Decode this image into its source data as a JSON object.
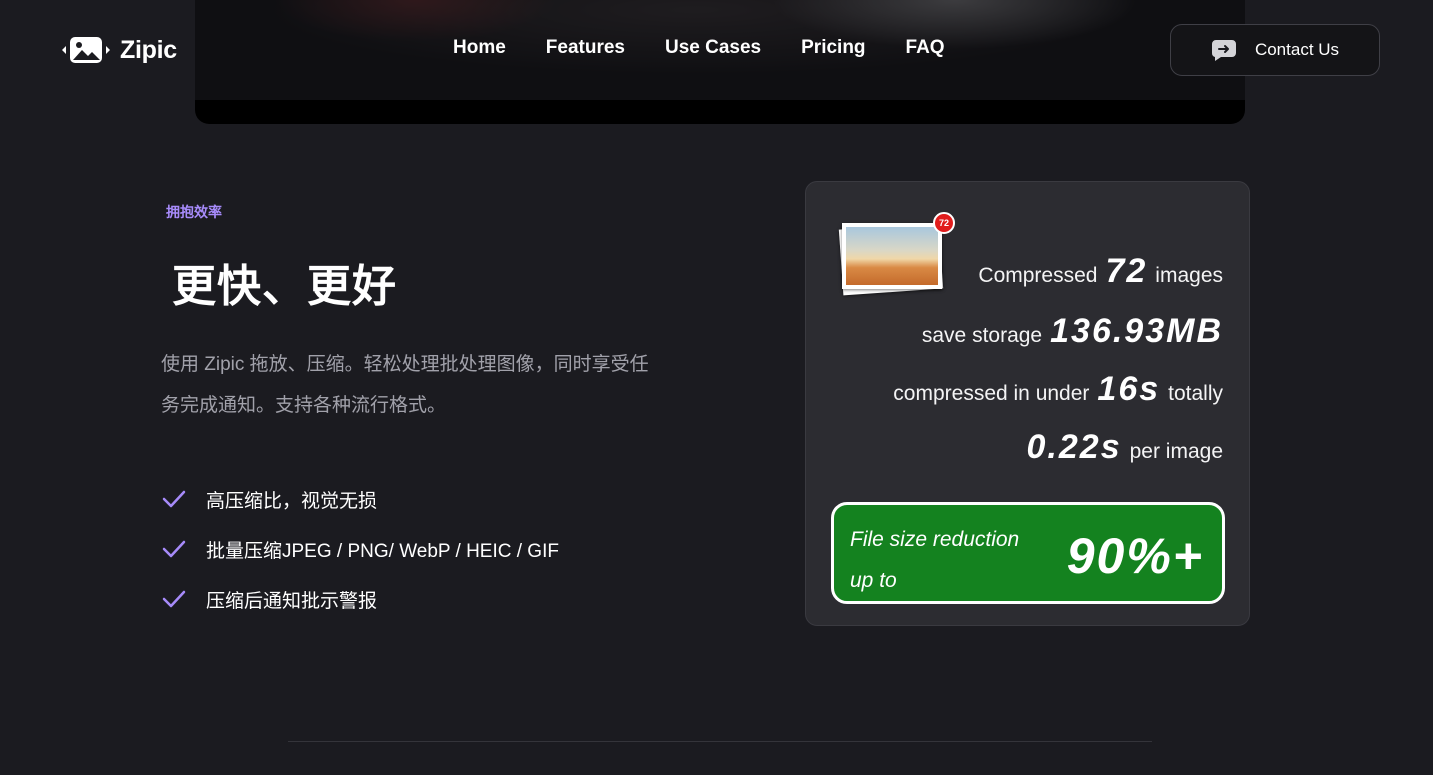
{
  "header": {
    "logo_text": "Zipic",
    "nav": [
      "Home",
      "Features",
      "Use Cases",
      "Pricing",
      "FAQ"
    ],
    "contact_label": "Contact Us"
  },
  "section": {
    "eyebrow": "拥抱效率",
    "title": "更快、更好",
    "description": "使用 Zipic 拖放、压缩。轻松处理批处理图像，同时享受任务完成通知。支持各种流行格式。",
    "features": [
      "高压缩比，视觉无损",
      "批量压缩JPEG / PNG/ WebP / HEIC / GIF",
      "压缩后通知批示警报"
    ]
  },
  "stats": {
    "badge_count": "72",
    "compressed_label": "Compressed",
    "compressed_count": "72",
    "compressed_suffix": "images",
    "storage_label": "save storage",
    "storage_value": "136.93MB",
    "time_label": "compressed in under",
    "time_value": "16s",
    "time_suffix": "totally",
    "per_image_value": "0.22s",
    "per_image_suffix": "per image",
    "reduction_label": "File size reduction up to",
    "reduction_value": "90%+"
  },
  "colors": {
    "accent": "#a78bfa",
    "background": "#1b1b20",
    "card": "#2c2c31",
    "reduction_green": "#14821f"
  },
  "icons": {
    "logo": "image-compress-logo-icon",
    "contact": "chat-bubble-icon",
    "feature": "check-icon",
    "badge": "notification-badge"
  }
}
